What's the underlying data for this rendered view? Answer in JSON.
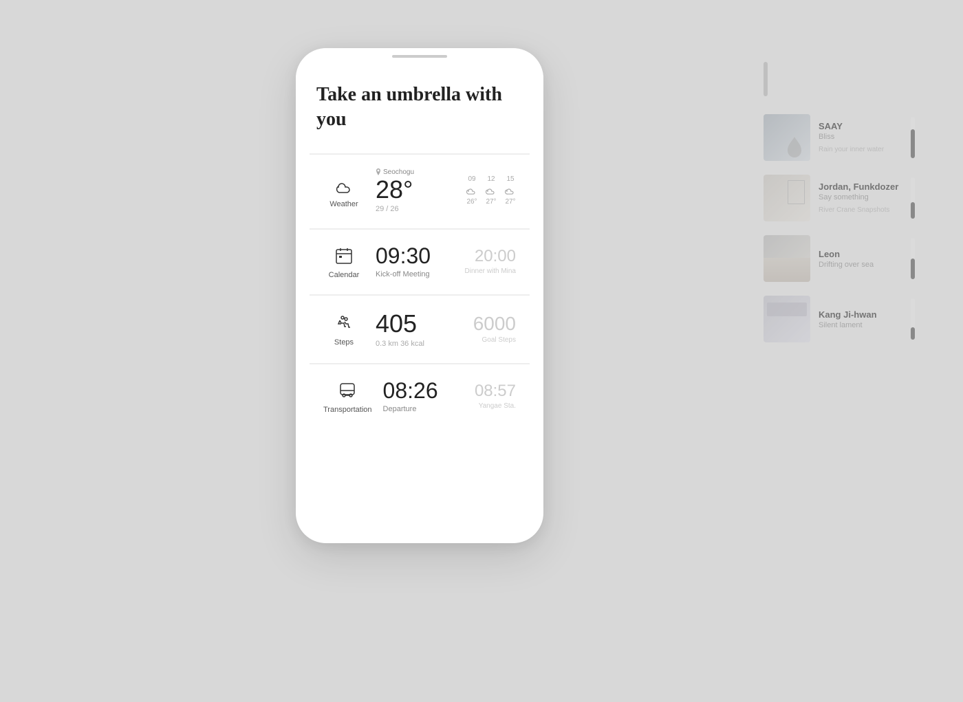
{
  "background": "#d8d8d8",
  "phone": {
    "header": {
      "title": "Take an umbrella with you"
    },
    "cards": {
      "weather": {
        "label": "Weather",
        "location": "Seochogu",
        "temperature": "28°",
        "range": "29 / 26",
        "forecast": [
          {
            "hour": "09",
            "temp": "26°"
          },
          {
            "hour": "12",
            "temp": "27°"
          },
          {
            "hour": "15",
            "temp": "27°"
          }
        ]
      },
      "calendar": {
        "label": "Calendar",
        "primary_time": "09:30",
        "primary_event": "Kick-off Meeting",
        "secondary_time": "20:00",
        "secondary_event": "Dinner with Mina"
      },
      "steps": {
        "label": "Steps",
        "count": "405",
        "detail": "0.3 km  36 kcal",
        "goal": "6000",
        "goal_label": "Goal Steps"
      },
      "transportation": {
        "label": "Transportation",
        "departure_time": "08:26",
        "departure_label": "Departure",
        "arrival_time": "08:57",
        "arrival_dest": "Yangae Sta."
      }
    }
  },
  "right_panel": {
    "tracks": [
      {
        "artist": "SAAY",
        "album": "Bliss",
        "description": "Rain your inner water",
        "bar_height": "70"
      },
      {
        "artist": "Jordan, Funkdozer",
        "album": "Say something",
        "description": "River Crane Snapshots",
        "bar_height": "40"
      },
      {
        "artist": "Leon",
        "album": "Drifting over sea",
        "description": "",
        "bar_height": "50"
      },
      {
        "artist": "Kang Ji-hwan",
        "album": "Silent lament",
        "description": "",
        "bar_height": "30"
      }
    ]
  }
}
